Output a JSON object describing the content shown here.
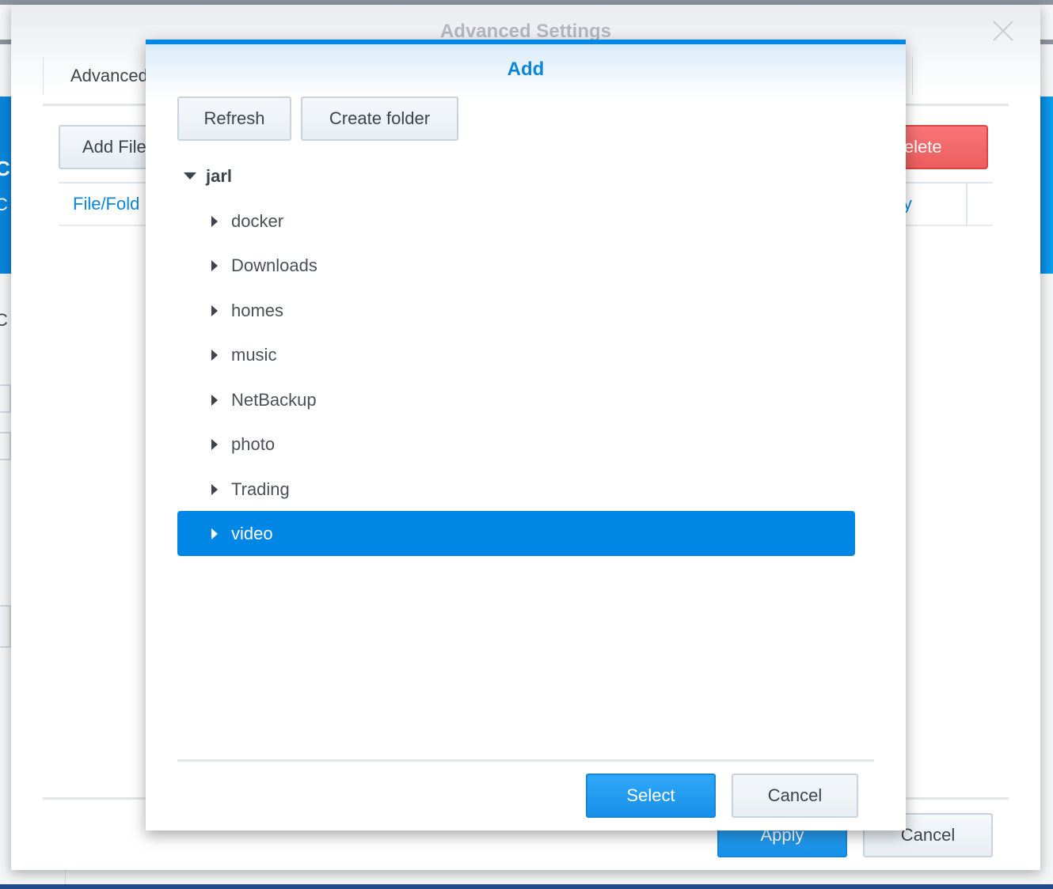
{
  "background": {
    "left_chars": [
      "C",
      "C",
      "C"
    ]
  },
  "window": {
    "title": "Advanced Settings",
    "tab": "Advanced",
    "add_button": "Add File",
    "delete_button": "Delete",
    "table_headers": [
      "File/Fold",
      "ly"
    ],
    "apply_button": "Apply",
    "cancel_button": "Cancel"
  },
  "dialog": {
    "title": "Add",
    "refresh_button": "Refresh",
    "create_folder_button": "Create folder",
    "root": "jarl",
    "folders": [
      "docker",
      "Downloads",
      "homes",
      "music",
      "NetBackup",
      "photo",
      "Trading",
      "video"
    ],
    "selected": "video",
    "select_button": "Select",
    "cancel_button": "Cancel"
  },
  "colors": {
    "accent": "#0086e5",
    "danger": "#ec5e5c"
  }
}
